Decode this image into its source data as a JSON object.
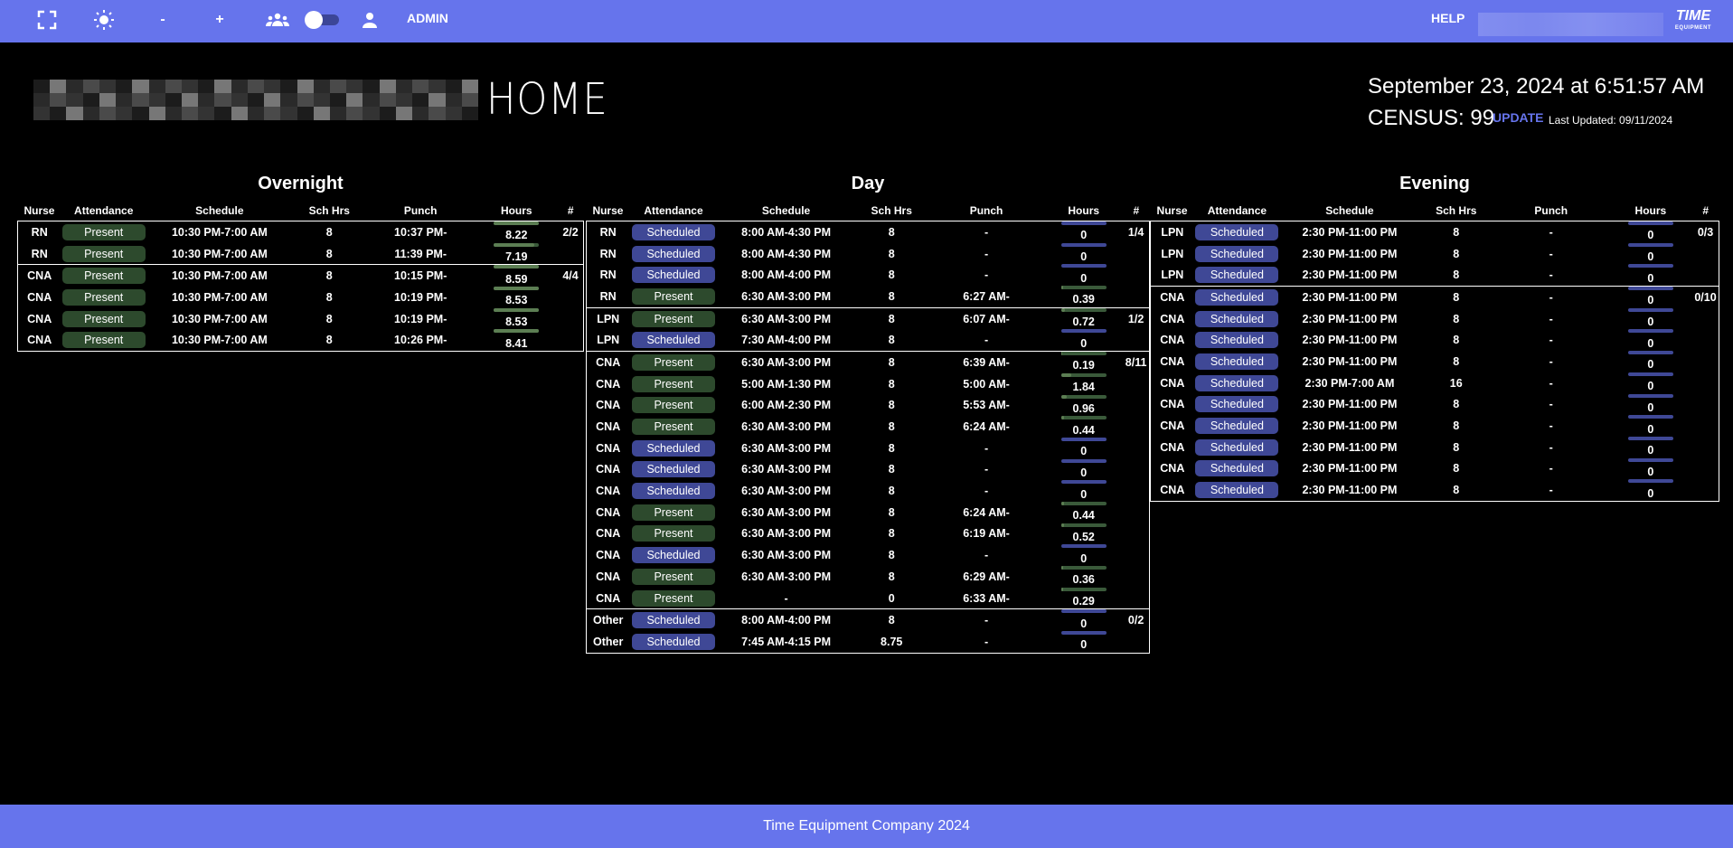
{
  "topbar": {
    "icons": [
      "fullscreen-icon",
      "brightness-icon",
      "zoom-out",
      "zoom-in",
      "group-icon",
      "theme-toggle",
      "person-icon"
    ],
    "zoom_out_label": "-",
    "zoom_in_label": "+",
    "user_label": "ADMIN",
    "help_label": "HELP",
    "logo_text": "TIME",
    "logo_sub": "EQUIPMENT"
  },
  "header": {
    "page_title": "HOME",
    "datetime": "September 23, 2024 at 6:51:57 AM",
    "census_label": "CENSUS: 99",
    "update_label": "UPDATE",
    "last_updated": "Last Updated: 09/11/2024"
  },
  "columns": [
    "Nurse",
    "Attendance",
    "Schedule",
    "Sch Hrs",
    "Punch",
    "Hours",
    "#"
  ],
  "colors": {
    "accent": "#6674ec",
    "present_badge": "#2d4a2d",
    "scheduled_badge": "#3f4896",
    "present_bar_track": "#3a5a3a",
    "present_bar_fill": "#5c7e53",
    "scheduled_bar": "#3f4896"
  },
  "shifts": [
    {
      "title": "Overnight",
      "groups": [
        {
          "count": "2/2",
          "rows": [
            {
              "nurse": "RN",
              "attendance": "Present",
              "schedule": "10:30 PM-7:00 AM",
              "sch_hrs": "8",
              "punch": "10:37 PM-",
              "hours": "8.22",
              "progress": 1.0
            },
            {
              "nurse": "RN",
              "attendance": "Present",
              "schedule": "10:30 PM-7:00 AM",
              "sch_hrs": "8",
              "punch": "11:39 PM-",
              "hours": "7.19",
              "progress": 0.9
            }
          ]
        },
        {
          "count": "4/4",
          "rows": [
            {
              "nurse": "CNA",
              "attendance": "Present",
              "schedule": "10:30 PM-7:00 AM",
              "sch_hrs": "8",
              "punch": "10:15 PM-",
              "hours": "8.59",
              "progress": 1.0
            },
            {
              "nurse": "CNA",
              "attendance": "Present",
              "schedule": "10:30 PM-7:00 AM",
              "sch_hrs": "8",
              "punch": "10:19 PM-",
              "hours": "8.53",
              "progress": 1.0
            },
            {
              "nurse": "CNA",
              "attendance": "Present",
              "schedule": "10:30 PM-7:00 AM",
              "sch_hrs": "8",
              "punch": "10:19 PM-",
              "hours": "8.53",
              "progress": 1.0
            },
            {
              "nurse": "CNA",
              "attendance": "Present",
              "schedule": "10:30 PM-7:00 AM",
              "sch_hrs": "8",
              "punch": "10:26 PM-",
              "hours": "8.41",
              "progress": 1.0
            }
          ]
        }
      ]
    },
    {
      "title": "Day",
      "groups": [
        {
          "count": "1/4",
          "rows": [
            {
              "nurse": "RN",
              "attendance": "Scheduled",
              "schedule": "8:00 AM-4:30 PM",
              "sch_hrs": "8",
              "punch": "-",
              "hours": "0",
              "progress": 0
            },
            {
              "nurse": "RN",
              "attendance": "Scheduled",
              "schedule": "8:00 AM-4:30 PM",
              "sch_hrs": "8",
              "punch": "-",
              "hours": "0",
              "progress": 0
            },
            {
              "nurse": "RN",
              "attendance": "Scheduled",
              "schedule": "8:00 AM-4:00 PM",
              "sch_hrs": "8",
              "punch": "-",
              "hours": "0",
              "progress": 0
            },
            {
              "nurse": "RN",
              "attendance": "Present",
              "schedule": "6:30 AM-3:00 PM",
              "sch_hrs": "8",
              "punch": "6:27 AM-",
              "hours": "0.39",
              "progress": 0.05
            }
          ]
        },
        {
          "count": "1/2",
          "rows": [
            {
              "nurse": "LPN",
              "attendance": "Present",
              "schedule": "6:30 AM-3:00 PM",
              "sch_hrs": "8",
              "punch": "6:07 AM-",
              "hours": "0.72",
              "progress": 0.09
            },
            {
              "nurse": "LPN",
              "attendance": "Scheduled",
              "schedule": "7:30 AM-4:00 PM",
              "sch_hrs": "8",
              "punch": "-",
              "hours": "0",
              "progress": 0
            }
          ]
        },
        {
          "count": "8/11",
          "rows": [
            {
              "nurse": "CNA",
              "attendance": "Present",
              "schedule": "6:30 AM-3:00 PM",
              "sch_hrs": "8",
              "punch": "6:39 AM-",
              "hours": "0.19",
              "progress": 0.02
            },
            {
              "nurse": "CNA",
              "attendance": "Present",
              "schedule": "5:00 AM-1:30 PM",
              "sch_hrs": "8",
              "punch": "5:00 AM-",
              "hours": "1.84",
              "progress": 0.23
            },
            {
              "nurse": "CNA",
              "attendance": "Present",
              "schedule": "6:00 AM-2:30 PM",
              "sch_hrs": "8",
              "punch": "5:53 AM-",
              "hours": "0.96",
              "progress": 0.12
            },
            {
              "nurse": "CNA",
              "attendance": "Present",
              "schedule": "6:30 AM-3:00 PM",
              "sch_hrs": "8",
              "punch": "6:24 AM-",
              "hours": "0.44",
              "progress": 0.06
            },
            {
              "nurse": "CNA",
              "attendance": "Scheduled",
              "schedule": "6:30 AM-3:00 PM",
              "sch_hrs": "8",
              "punch": "-",
              "hours": "0",
              "progress": 0
            },
            {
              "nurse": "CNA",
              "attendance": "Scheduled",
              "schedule": "6:30 AM-3:00 PM",
              "sch_hrs": "8",
              "punch": "-",
              "hours": "0",
              "progress": 0
            },
            {
              "nurse": "CNA",
              "attendance": "Scheduled",
              "schedule": "6:30 AM-3:00 PM",
              "sch_hrs": "8",
              "punch": "-",
              "hours": "0",
              "progress": 0
            },
            {
              "nurse": "CNA",
              "attendance": "Present",
              "schedule": "6:30 AM-3:00 PM",
              "sch_hrs": "8",
              "punch": "6:24 AM-",
              "hours": "0.44",
              "progress": 0.06
            },
            {
              "nurse": "CNA",
              "attendance": "Present",
              "schedule": "6:30 AM-3:00 PM",
              "sch_hrs": "8",
              "punch": "6:19 AM-",
              "hours": "0.52",
              "progress": 0.07
            },
            {
              "nurse": "CNA",
              "attendance": "Scheduled",
              "schedule": "6:30 AM-3:00 PM",
              "sch_hrs": "8",
              "punch": "-",
              "hours": "0",
              "progress": 0
            },
            {
              "nurse": "CNA",
              "attendance": "Present",
              "schedule": "6:30 AM-3:00 PM",
              "sch_hrs": "8",
              "punch": "6:29 AM-",
              "hours": "0.36",
              "progress": 0.05
            },
            {
              "nurse": "CNA",
              "attendance": "Present",
              "schedule": "-",
              "sch_hrs": "0",
              "punch": "6:33 AM-",
              "hours": "0.29",
              "progress": 0.04
            }
          ]
        },
        {
          "count": "0/2",
          "rows": [
            {
              "nurse": "Other",
              "attendance": "Scheduled",
              "schedule": "8:00 AM-4:00 PM",
              "sch_hrs": "8",
              "punch": "-",
              "hours": "0",
              "progress": 0
            },
            {
              "nurse": "Other",
              "attendance": "Scheduled",
              "schedule": "7:45 AM-4:15 PM",
              "sch_hrs": "8.75",
              "punch": "-",
              "hours": "0",
              "progress": 0
            }
          ]
        }
      ]
    },
    {
      "title": "Evening",
      "groups": [
        {
          "count": "0/3",
          "rows": [
            {
              "nurse": "LPN",
              "attendance": "Scheduled",
              "schedule": "2:30 PM-11:00 PM",
              "sch_hrs": "8",
              "punch": "-",
              "hours": "0",
              "progress": 0
            },
            {
              "nurse": "LPN",
              "attendance": "Scheduled",
              "schedule": "2:30 PM-11:00 PM",
              "sch_hrs": "8",
              "punch": "-",
              "hours": "0",
              "progress": 0
            },
            {
              "nurse": "LPN",
              "attendance": "Scheduled",
              "schedule": "2:30 PM-11:00 PM",
              "sch_hrs": "8",
              "punch": "-",
              "hours": "0",
              "progress": 0
            }
          ]
        },
        {
          "count": "0/10",
          "rows": [
            {
              "nurse": "CNA",
              "attendance": "Scheduled",
              "schedule": "2:30 PM-11:00 PM",
              "sch_hrs": "8",
              "punch": "-",
              "hours": "0",
              "progress": 0
            },
            {
              "nurse": "CNA",
              "attendance": "Scheduled",
              "schedule": "2:30 PM-11:00 PM",
              "sch_hrs": "8",
              "punch": "-",
              "hours": "0",
              "progress": 0
            },
            {
              "nurse": "CNA",
              "attendance": "Scheduled",
              "schedule": "2:30 PM-11:00 PM",
              "sch_hrs": "8",
              "punch": "-",
              "hours": "0",
              "progress": 0
            },
            {
              "nurse": "CNA",
              "attendance": "Scheduled",
              "schedule": "2:30 PM-11:00 PM",
              "sch_hrs": "8",
              "punch": "-",
              "hours": "0",
              "progress": 0
            },
            {
              "nurse": "CNA",
              "attendance": "Scheduled",
              "schedule": "2:30 PM-7:00 AM",
              "sch_hrs": "16",
              "punch": "-",
              "hours": "0",
              "progress": 0
            },
            {
              "nurse": "CNA",
              "attendance": "Scheduled",
              "schedule": "2:30 PM-11:00 PM",
              "sch_hrs": "8",
              "punch": "-",
              "hours": "0",
              "progress": 0
            },
            {
              "nurse": "CNA",
              "attendance": "Scheduled",
              "schedule": "2:30 PM-11:00 PM",
              "sch_hrs": "8",
              "punch": "-",
              "hours": "0",
              "progress": 0
            },
            {
              "nurse": "CNA",
              "attendance": "Scheduled",
              "schedule": "2:30 PM-11:00 PM",
              "sch_hrs": "8",
              "punch": "-",
              "hours": "0",
              "progress": 0
            },
            {
              "nurse": "CNA",
              "attendance": "Scheduled",
              "schedule": "2:30 PM-11:00 PM",
              "sch_hrs": "8",
              "punch": "-",
              "hours": "0",
              "progress": 0
            },
            {
              "nurse": "CNA",
              "attendance": "Scheduled",
              "schedule": "2:30 PM-11:00 PM",
              "sch_hrs": "8",
              "punch": "-",
              "hours": "0",
              "progress": 0
            }
          ]
        }
      ]
    }
  ],
  "footer": {
    "text": "Time Equipment Company 2024"
  }
}
